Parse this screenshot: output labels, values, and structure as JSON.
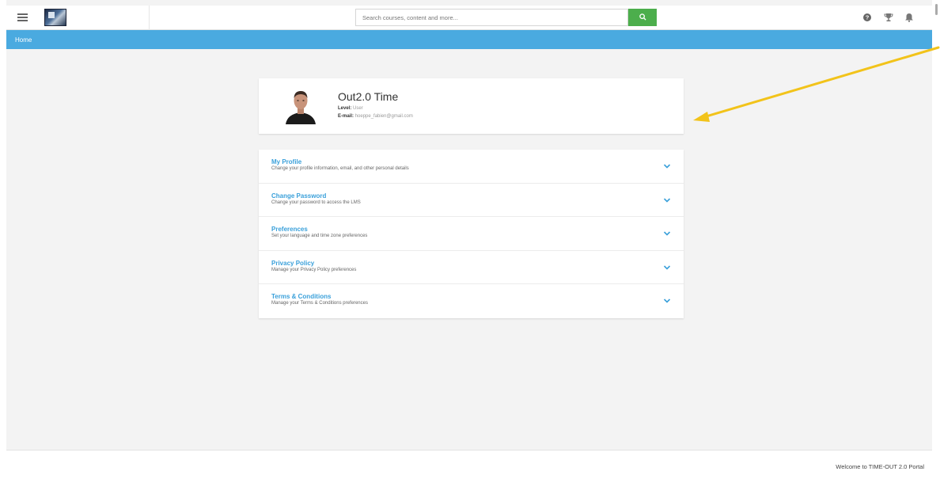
{
  "header": {
    "search_placeholder": "Search courses, content and more...",
    "icons": [
      "menu-icon",
      "help-icon",
      "trophy-icon",
      "bell-icon"
    ]
  },
  "breadcrumb": {
    "home": "Home"
  },
  "profile": {
    "name": "Out2.0 Time",
    "level_label": "Level:",
    "level_value": "User",
    "email_label": "E-mail:",
    "email_value": "hoeppe_fabien@gmail.com"
  },
  "sections": [
    {
      "title": "My Profile",
      "subtitle": "Change your profile information, email, and other personal details"
    },
    {
      "title": "Change Password",
      "subtitle": "Change your password to access the LMS"
    },
    {
      "title": "Preferences",
      "subtitle": "Set your language and time zone preferences"
    },
    {
      "title": "Privacy Policy",
      "subtitle": "Manage your Privacy Policy preferences"
    },
    {
      "title": "Terms & Conditions",
      "subtitle": "Manage your Terms & Conditions preferences"
    }
  ],
  "footer": {
    "text": "Welcome to TIME-OUT 2.0 Portal"
  },
  "colors": {
    "accent_blue": "#4aaae0",
    "link_blue": "#3aa0da",
    "search_green": "#4cae4c",
    "arrow_yellow": "#f2c31a"
  }
}
